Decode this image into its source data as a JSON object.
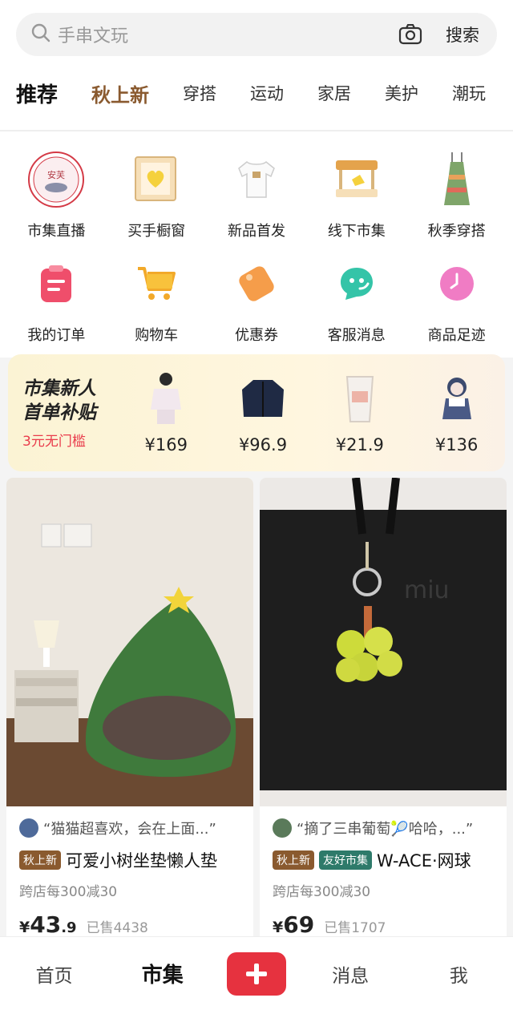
{
  "search": {
    "placeholder": "手串文玩",
    "button": "搜索",
    "camera_icon": "camera-icon",
    "search_icon": "search-icon"
  },
  "tabs": [
    {
      "label": "推荐"
    },
    {
      "label": "秋上新"
    },
    {
      "label": "穿搭"
    },
    {
      "label": "运动"
    },
    {
      "label": "家居"
    },
    {
      "label": "美护"
    },
    {
      "label": "潮玩"
    }
  ],
  "shortcuts": [
    {
      "label": "市集直播",
      "icon": "live-stamp-icon"
    },
    {
      "label": "买手橱窗",
      "icon": "heart-showcase-icon"
    },
    {
      "label": "新品首发",
      "icon": "tshirt-icon"
    },
    {
      "label": "线下市集",
      "icon": "market-stall-icon"
    },
    {
      "label": "秋季穿搭",
      "icon": "dress-icon"
    },
    {
      "label": "我的订单",
      "icon": "order-clipboard-icon"
    },
    {
      "label": "购物车",
      "icon": "cart-icon"
    },
    {
      "label": "优惠券",
      "icon": "coupon-icon"
    },
    {
      "label": "客服消息",
      "icon": "chat-icon"
    },
    {
      "label": "商品足迹",
      "icon": "clock-icon"
    }
  ],
  "banner": {
    "line1": "市集新人",
    "line2": "首单补贴",
    "line3": "3元无门槛",
    "products": [
      {
        "price": "¥169",
        "icon": "hoodie-figure-icon"
      },
      {
        "price": "¥96.9",
        "icon": "jacket-icon"
      },
      {
        "price": "¥21.9",
        "icon": "glass-cup-icon"
      },
      {
        "price": "¥136",
        "icon": "doll-icon"
      }
    ]
  },
  "cards": [
    {
      "quote": "“猫猫超喜欢，会在上面...”",
      "tags": [
        "秋上新"
      ],
      "title": "可爱小树坐垫懒人垫",
      "promo": "跨店每300减30",
      "price_main": "43",
      "price_dec": ".9",
      "currency": "¥",
      "sold": "已售4438"
    },
    {
      "quote": "“摘了三串葡萄🎾哈哈，...”",
      "tags": [
        "秋上新",
        "友好市集"
      ],
      "title": "W-ACE·网球",
      "promo": "跨店每300减30",
      "price_main": "69",
      "price_dec": "",
      "currency": "¥",
      "sold": "已售1707"
    }
  ],
  "nav": {
    "home": "首页",
    "market": "市集",
    "messages": "消息",
    "me": "我"
  },
  "colors": {
    "accent": "#e6323f",
    "brown": "#8a5a2f",
    "green_tag": "#2e7a6a"
  }
}
